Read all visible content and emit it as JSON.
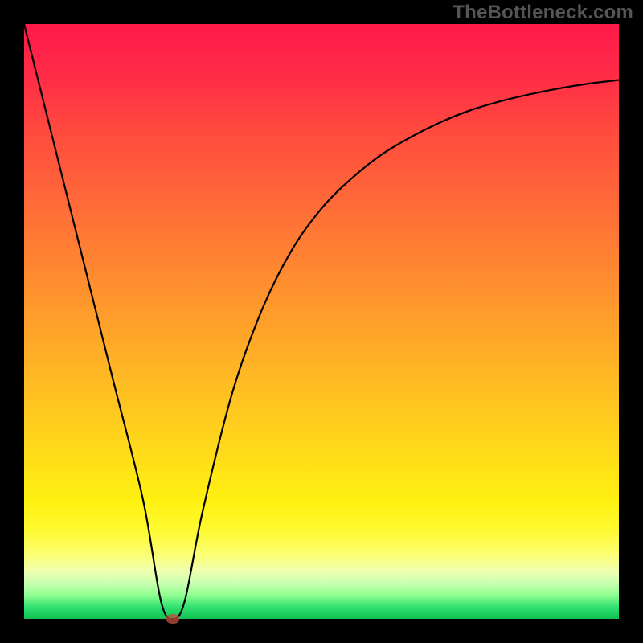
{
  "watermark": "TheBottleneck.com",
  "colors": {
    "frame": "#000000",
    "curve": "#000000",
    "marker": "#c05040",
    "gradient_top": "#ff1a4a",
    "gradient_mid": "#ffe018",
    "gradient_bottom": "#10c050"
  },
  "chart_data": {
    "type": "line",
    "title": "",
    "xlabel": "",
    "ylabel": "",
    "xlim": [
      0,
      100
    ],
    "ylim": [
      0,
      100
    ],
    "grid": false,
    "series": [
      {
        "name": "bottleneck-curve",
        "x": [
          0,
          5,
          10,
          15,
          20,
          23,
          25,
          27,
          30,
          35,
          40,
          45,
          50,
          55,
          60,
          65,
          70,
          75,
          80,
          85,
          90,
          95,
          100
        ],
        "y": [
          100,
          80,
          60,
          40,
          20,
          3,
          0,
          3,
          18,
          38,
          52,
          62,
          69,
          74,
          78,
          81,
          83.5,
          85.5,
          87,
          88.2,
          89.2,
          90,
          90.6
        ]
      }
    ],
    "annotations": [
      {
        "name": "min-marker",
        "x": 25,
        "y": 0
      }
    ]
  }
}
